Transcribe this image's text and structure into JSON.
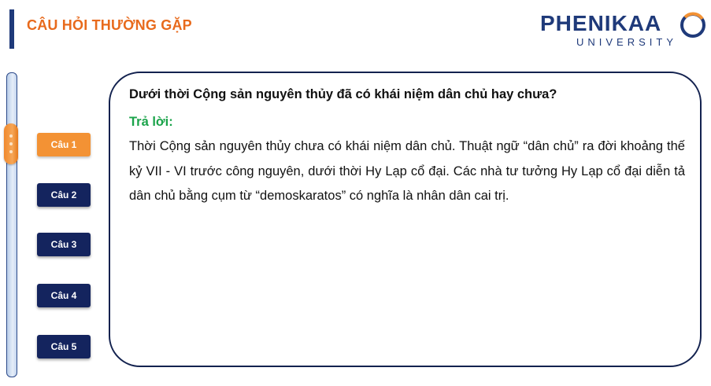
{
  "header": {
    "title": "CÂU HỎI THƯỜNG GẶP",
    "logo_name": "PHENIKAA",
    "logo_sub": "UNIVERSITY"
  },
  "sidebar": {
    "buttons": [
      {
        "label": "Câu 1",
        "active": true
      },
      {
        "label": "Câu 2",
        "active": false
      },
      {
        "label": "Câu 3",
        "active": false
      },
      {
        "label": "Câu 4",
        "active": false
      },
      {
        "label": "Câu 5",
        "active": false
      }
    ]
  },
  "content": {
    "question": "Dưới thời Cộng sản nguyên thủy đã có khái niệm dân chủ hay chưa?",
    "answer_label": "Trả lời:",
    "answer_text": "Thời Cộng sản nguyên thủy chưa có khái niệm dân chủ. Thuật ngữ “dân chủ” ra đời khoảng thế kỷ VII - VI trước công nguyên, dưới thời Hy Lạp cổ đại. Các nhà tư tưởng Hy Lạp cổ đại diễn tả dân chủ bằng cụm từ “demoskaratos” có nghĩa là nhân dân cai trị."
  },
  "colors": {
    "navy": "#14245e",
    "orange": "#f39234",
    "title_orange": "#e86a1c",
    "answer_green": "#1aa34a"
  }
}
